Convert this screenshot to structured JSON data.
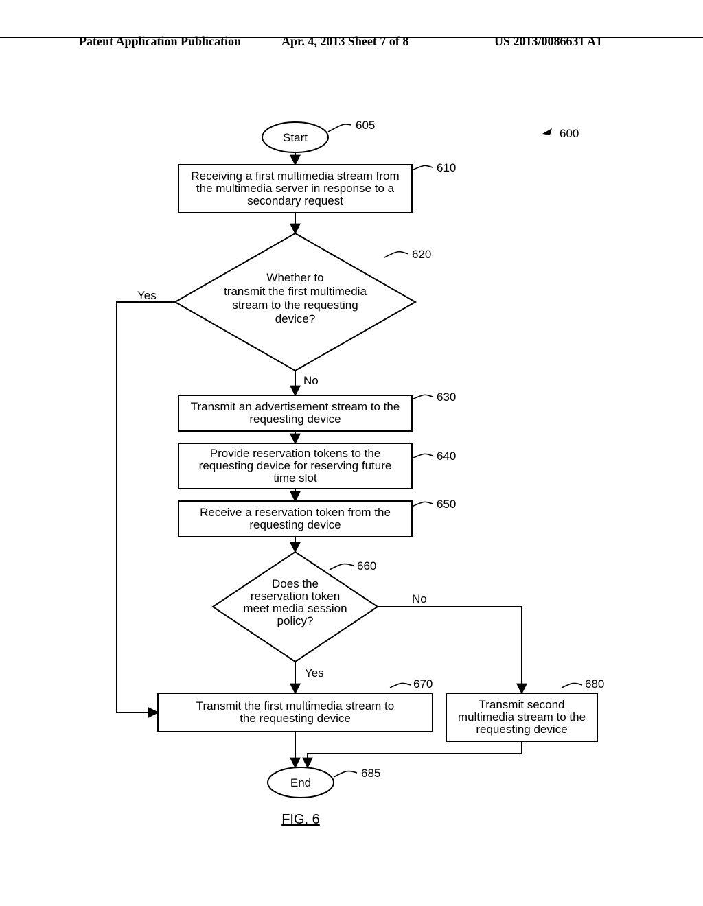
{
  "header": {
    "left": "Patent Application Publication",
    "mid": "Apr. 4, 2013  Sheet 7 of 8",
    "right": "US 2013/0086631 A1"
  },
  "figure": {
    "caption": "FIG. 6",
    "ref_600": "600"
  },
  "nodes": {
    "n605": {
      "text1": "Start",
      "ref": "605"
    },
    "n610": {
      "text1": "Receiving a first multimedia stream from",
      "text2": "the multimedia server in response to a",
      "text3": "secondary request",
      "ref": "610"
    },
    "n620": {
      "text1": "Whether to",
      "text2": "transmit the first multimedia",
      "text3": "stream to the requesting",
      "text4": "device?",
      "ref": "620"
    },
    "n630": {
      "text1": "Transmit an advertisement stream to the",
      "text2": "requesting device",
      "ref": "630"
    },
    "n640": {
      "text1": "Provide reservation tokens to the",
      "text2": "requesting device for reserving future",
      "text3": "time slot",
      "ref": "640"
    },
    "n650": {
      "text1": "Receive a reservation token from the",
      "text2": "requesting device",
      "ref": "650"
    },
    "n660": {
      "text1": "Does the",
      "text2": "reservation token",
      "text3": "meet media session",
      "text4": "policy?",
      "ref": "660"
    },
    "n670": {
      "text1": "Transmit the first multimedia stream to",
      "text2": "the requesting device",
      "ref": "670"
    },
    "n680": {
      "text1": "Transmit second",
      "text2": "multimedia stream to the",
      "text3": "requesting device",
      "ref": "680"
    },
    "n685": {
      "text1": "End",
      "ref": "685"
    }
  },
  "edges": {
    "yes1": "Yes",
    "no1": "No",
    "yes2": "Yes",
    "no2": "No"
  }
}
